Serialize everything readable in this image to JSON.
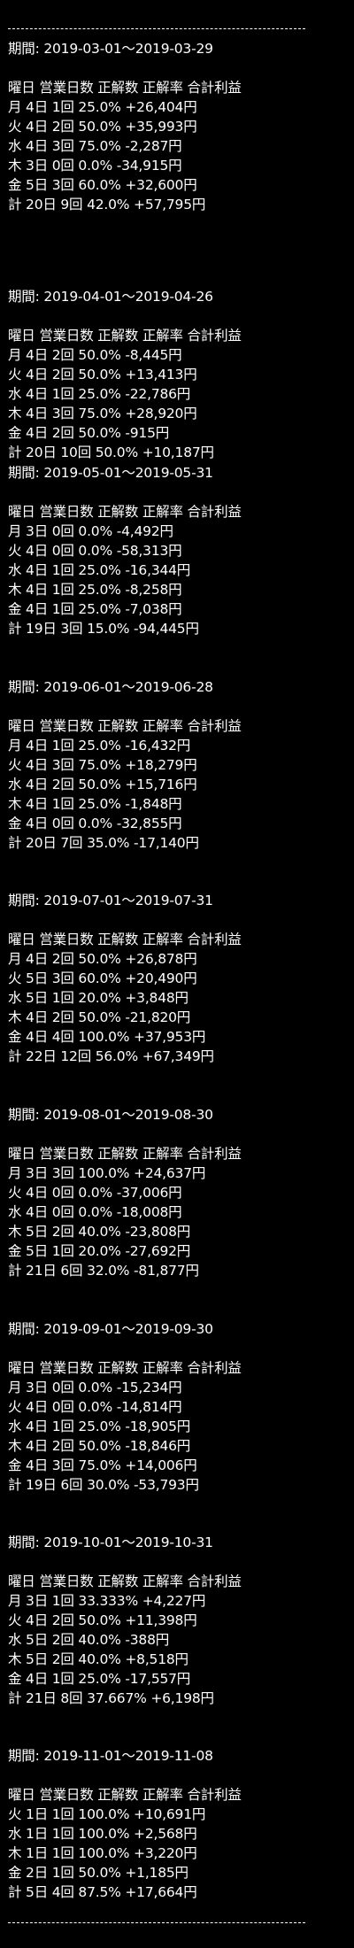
{
  "separator_top": "--------------------------------------------------------",
  "separator_bottom": "--------------------------------------------------------",
  "sections": [
    {
      "period": "期間: 2019-03-01～2019-03-29",
      "header": "曜日 営業日数 正解数 正解率 合計利益",
      "rows": [
        "月 4日 1回 25.0% +26,404円",
        "火 4日 2回 50.0% +35,993円",
        "水 4日 3回 75.0% -2,287円",
        "木 3日 0回 0.0% -34,915円",
        "金 5日 3回 60.0% +32,600円",
        "計 20日 9回 42.0% +57,795円"
      ]
    },
    {
      "period": "期間: 2019-04-01～2019-04-26",
      "header": "曜日 営業日数 正解数 正解率 合計利益",
      "rows": [
        "月 4日 2回 50.0% -8,445円",
        "火 4日 2回 50.0% +13,413円",
        "水 4日 1回 25.0% -22,786円",
        "木 4日 3回 75.0% +28,920円",
        "金 4日 2回 50.0% -915円",
        "計 20日 10回 50.0% +10,187円"
      ]
    },
    {
      "period": "期間: 2019-05-01～2019-05-31",
      "header": "曜日 営業日数 正解数 正解率 合計利益",
      "rows": [
        "月 3日 0回 0.0% -4,492円",
        "火 4日 0回 0.0% -58,313円",
        "水 4日 1回 25.0% -16,344円",
        "木 4日 1回 25.0% -8,258円",
        "金 4日 1回 25.0% -7,038円",
        "計 19日 3回 15.0% -94,445円"
      ]
    },
    {
      "period": "期間: 2019-06-01～2019-06-28",
      "header": "曜日 営業日数 正解数 正解率 合計利益",
      "rows": [
        "月 4日 1回 25.0% -16,432円",
        "火 4日 3回 75.0% +18,279円",
        "水 4日 2回 50.0% +15,716円",
        "木 4日 1回 25.0% -1,848円",
        "金 4日 0回 0.0% -32,855円",
        "計 20日 7回 35.0% -17,140円"
      ]
    },
    {
      "period": "期間: 2019-07-01～2019-07-31",
      "header": "曜日 営業日数 正解数 正解率 合計利益",
      "rows": [
        "月 4日 2回 50.0% +26,878円",
        "火 5日 3回 60.0% +20,490円",
        "水 5日 1回 20.0% +3,848円",
        "木 4日 2回 50.0% -21,820円",
        "金 4日 4回 100.0% +37,953円",
        "計 22日 12回 56.0% +67,349円"
      ]
    },
    {
      "period": "期間: 2019-08-01～2019-08-30",
      "header": "曜日 営業日数 正解数 正解率 合計利益",
      "rows": [
        "月 3日 3回 100.0% +24,637円",
        "火 4日 0回 0.0% -37,006円",
        "水 4日 0回 0.0% -18,008円",
        "木 5日 2回 40.0% -23,808円",
        "金 5日 1回 20.0% -27,692円",
        "計 21日 6回 32.0% -81,877円"
      ]
    },
    {
      "period": "期間: 2019-09-01～2019-09-30",
      "header": "曜日 営業日数 正解数 正解率 合計利益",
      "rows": [
        "月 3日 0回 0.0% -15,234円",
        "火 4日 0回 0.0% -14,814円",
        "水 4日 1回 25.0% -18,905円",
        "木 4日 2回 50.0% -18,846円",
        "金 4日 3回 75.0% +14,006円",
        "計 19日 6回 30.0% -53,793円"
      ]
    },
    {
      "period": "期間: 2019-10-01～2019-10-31",
      "header": "曜日 営業日数 正解数 正解率 合計利益",
      "rows": [
        "月 3日 1回 33.333% +4,227円",
        "火 4日 2回 50.0% +11,398円",
        "水 5日 2回 40.0% -388円",
        "木 5日 2回 40.0% +8,518円",
        "金 4日 1回 25.0% -17,557円",
        "計 21日 8回 37.667% +6,198円"
      ]
    },
    {
      "period": "期間: 2019-11-01～2019-11-08",
      "header": "曜日 営業日数 正解数 正解率 合計利益",
      "rows": [
        "火 1日 1回 100.0% +10,691円",
        "水 1日 1回 100.0% +2,568円",
        "木 1日 1回 100.0% +3,220円",
        "金 2日 1回 50.0% +1,185円",
        "計 5日 4回 87.5% +17,664円"
      ]
    }
  ]
}
